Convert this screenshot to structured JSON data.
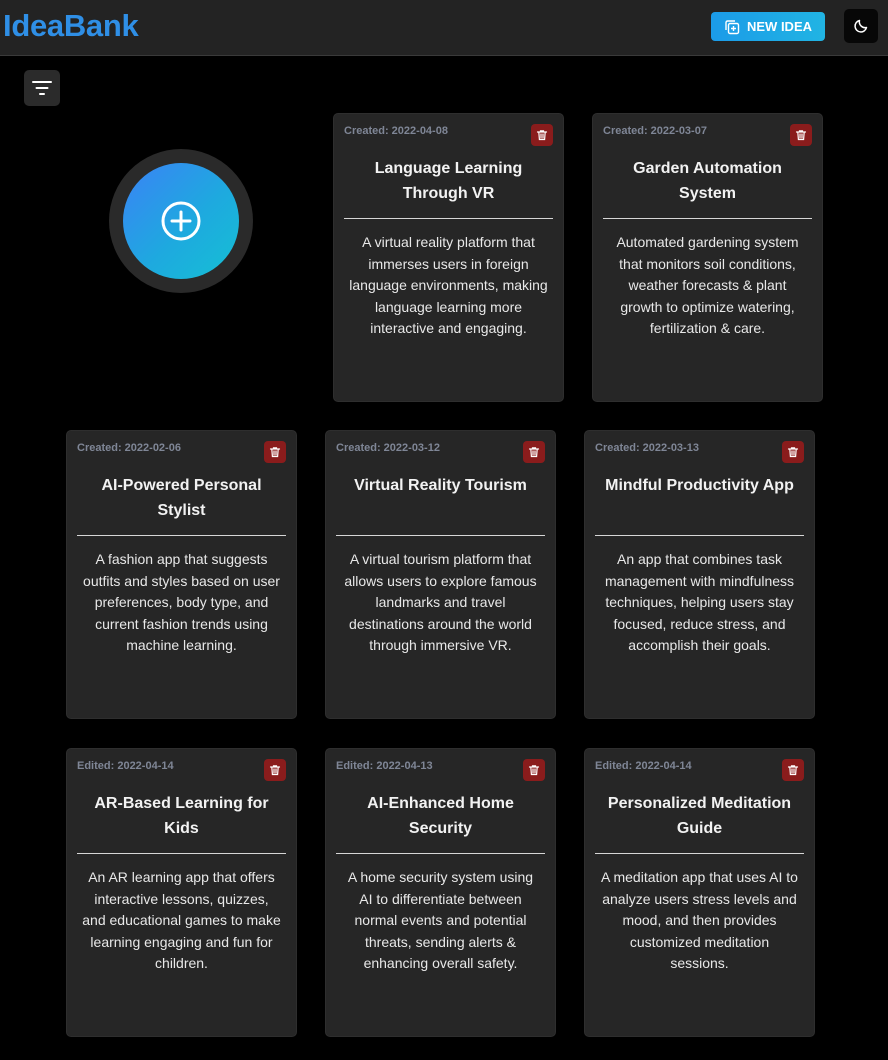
{
  "app": {
    "title": "IdeaBank"
  },
  "header": {
    "new_idea_label": "NEW IDEA",
    "new_idea_icon": "add-square-icon",
    "theme_icon": "moon-icon"
  },
  "toolbar": {
    "filter_icon": "filter-lines-icon"
  },
  "add_button": {
    "icon": "plus-circle-icon",
    "colors": [
      "#3b82f6",
      "#15c0d4"
    ]
  },
  "colors": {
    "accent": "#2f8fe6",
    "delete": "#8a1c1c",
    "card": "#262626",
    "background": "#000000"
  },
  "cards": [
    {
      "date": "Created: 2022-04-08",
      "title": "Language Learning Through VR",
      "description": "A virtual reality platform that immerses users in foreign language environments, making language learning more interactive and engaging."
    },
    {
      "date": "Created: 2022-03-07",
      "title": "Garden Automation System",
      "description": "Automated gardening system that monitors soil conditions, weather forecasts & plant growth to optimize watering, fertilization & care."
    },
    {
      "date": "Created: 2022-02-06",
      "title": "AI-Powered Personal Stylist",
      "description": "A fashion app that suggests outfits and styles based on user preferences, body type, and current fashion trends using machine learning."
    },
    {
      "date": "Created: 2022-03-12",
      "title": "Virtual Reality Tourism",
      "description": "A virtual tourism platform that allows users to explore famous landmarks and travel destinations around the world through immersive VR."
    },
    {
      "date": "Created: 2022-03-13",
      "title": "Mindful Productivity App",
      "description": "An app that combines task management with mindfulness techniques, helping users stay focused, reduce stress, and accomplish their goals."
    },
    {
      "date": "Edited: 2022-04-14",
      "title": "AR-Based Learning for Kids",
      "description": "An AR learning app that offers interactive lessons, quizzes, and educational games to make learning engaging and fun for children."
    },
    {
      "date": "Edited: 2022-04-13",
      "title": "AI-Enhanced Home Security",
      "description": "A home security system using AI to differentiate between normal events and potential threats, sending alerts & enhancing overall safety."
    },
    {
      "date": "Edited: 2022-04-14",
      "title": "Personalized Meditation Guide",
      "description": "A meditation app that uses AI to analyze users stress levels and mood, and then provides customized meditation sessions."
    }
  ]
}
